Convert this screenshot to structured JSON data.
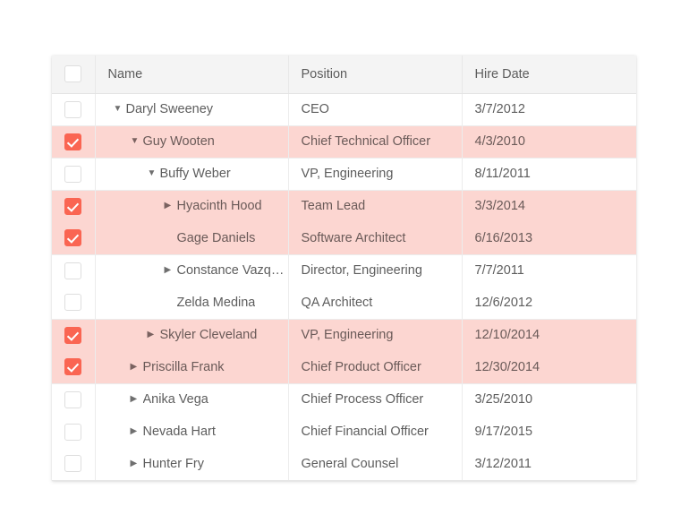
{
  "table": {
    "columns": [
      {
        "key": "check",
        "label": ""
      },
      {
        "key": "name",
        "label": "Name"
      },
      {
        "key": "position",
        "label": "Position"
      },
      {
        "key": "hire_date",
        "label": "Hire Date"
      }
    ],
    "header": {
      "select_all_checked": false,
      "name_label": "Name",
      "position_label": "Position",
      "hire_date_label": "Hire Date"
    },
    "colors": {
      "selected_row_bg": "#fcd6d1",
      "checkbox_checked_bg": "#fa6552",
      "header_bg": "#f4f4f4",
      "border": "#ececec",
      "text": "#5d5d5d",
      "page_bg": "#ffffff"
    },
    "icons": {
      "expanded": "▼",
      "collapsed": "▶",
      "checkmark": "✓"
    },
    "rows": [
      {
        "name": "Daryl Sweeney",
        "position": "CEO",
        "hire_date": "3/7/2012",
        "depth": 0,
        "toggle": "expanded",
        "checked": false
      },
      {
        "name": "Guy Wooten",
        "position": "Chief Technical Officer",
        "hire_date": "4/3/2010",
        "depth": 1,
        "toggle": "expanded",
        "checked": true
      },
      {
        "name": "Buffy Weber",
        "position": "VP, Engineering",
        "hire_date": "8/11/2011",
        "depth": 2,
        "toggle": "expanded",
        "checked": false
      },
      {
        "name": "Hyacinth Hood",
        "position": "Team Lead",
        "hire_date": "3/3/2014",
        "depth": 3,
        "toggle": "collapsed",
        "checked": true
      },
      {
        "name": "Gage Daniels",
        "position": "Software Architect",
        "hire_date": "6/16/2013",
        "depth": 3,
        "toggle": "none",
        "checked": true
      },
      {
        "name": "Constance Vazquez",
        "position": "Director, Engineering",
        "hire_date": "7/7/2011",
        "depth": 3,
        "toggle": "collapsed",
        "checked": false
      },
      {
        "name": "Zelda Medina",
        "position": "QA Architect",
        "hire_date": "12/6/2012",
        "depth": 3,
        "toggle": "none",
        "checked": false
      },
      {
        "name": "Skyler Cleveland",
        "position": "VP, Engineering",
        "hire_date": "12/10/2014",
        "depth": 2,
        "toggle": "collapsed",
        "checked": true
      },
      {
        "name": "Priscilla Frank",
        "position": "Chief Product Officer",
        "hire_date": "12/30/2014",
        "depth": 1,
        "toggle": "collapsed",
        "checked": true
      },
      {
        "name": "Anika Vega",
        "position": "Chief Process Officer",
        "hire_date": "3/25/2010",
        "depth": 1,
        "toggle": "collapsed",
        "checked": false
      },
      {
        "name": "Nevada Hart",
        "position": "Chief Financial Officer",
        "hire_date": "9/17/2015",
        "depth": 1,
        "toggle": "collapsed",
        "checked": false
      },
      {
        "name": "Hunter Fry",
        "position": "General Counsel",
        "hire_date": "3/12/2011",
        "depth": 1,
        "toggle": "collapsed",
        "checked": false
      }
    ]
  }
}
